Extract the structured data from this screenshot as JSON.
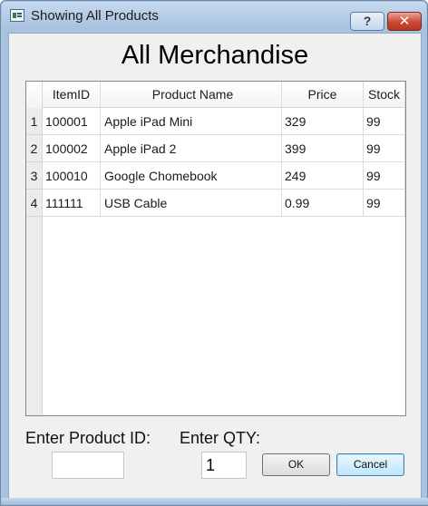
{
  "window": {
    "title": "Showing All Products",
    "help_label": "?",
    "close_label": "✕"
  },
  "heading": "All Merchandise",
  "table": {
    "columns": [
      "ItemID",
      "Product Name",
      "Price",
      "Stock"
    ],
    "rows": [
      {
        "num": "1",
        "id": "100001",
        "name": "Apple iPad Mini",
        "price": "329",
        "stock": "99"
      },
      {
        "num": "2",
        "id": "100002",
        "name": "Apple iPad 2",
        "price": "399",
        "stock": "99"
      },
      {
        "num": "3",
        "id": "100010",
        "name": "Google Chomebook",
        "price": "249",
        "stock": "99"
      },
      {
        "num": "4",
        "id": "111111",
        "name": "USB Cable",
        "price": "0.99",
        "stock": "99"
      }
    ]
  },
  "form": {
    "product_id_label": "Enter Product ID:",
    "product_id_value": "",
    "qty_label": "Enter QTY:",
    "qty_value": "1",
    "ok_label": "OK",
    "cancel_label": "Cancel"
  },
  "colors": {
    "title_bar": "#a7c1df",
    "close_button": "#c94a35",
    "client_bg": "#f0f0f0"
  },
  "icons": {
    "app": "window-app-icon",
    "help": "help-icon",
    "close": "close-icon"
  }
}
